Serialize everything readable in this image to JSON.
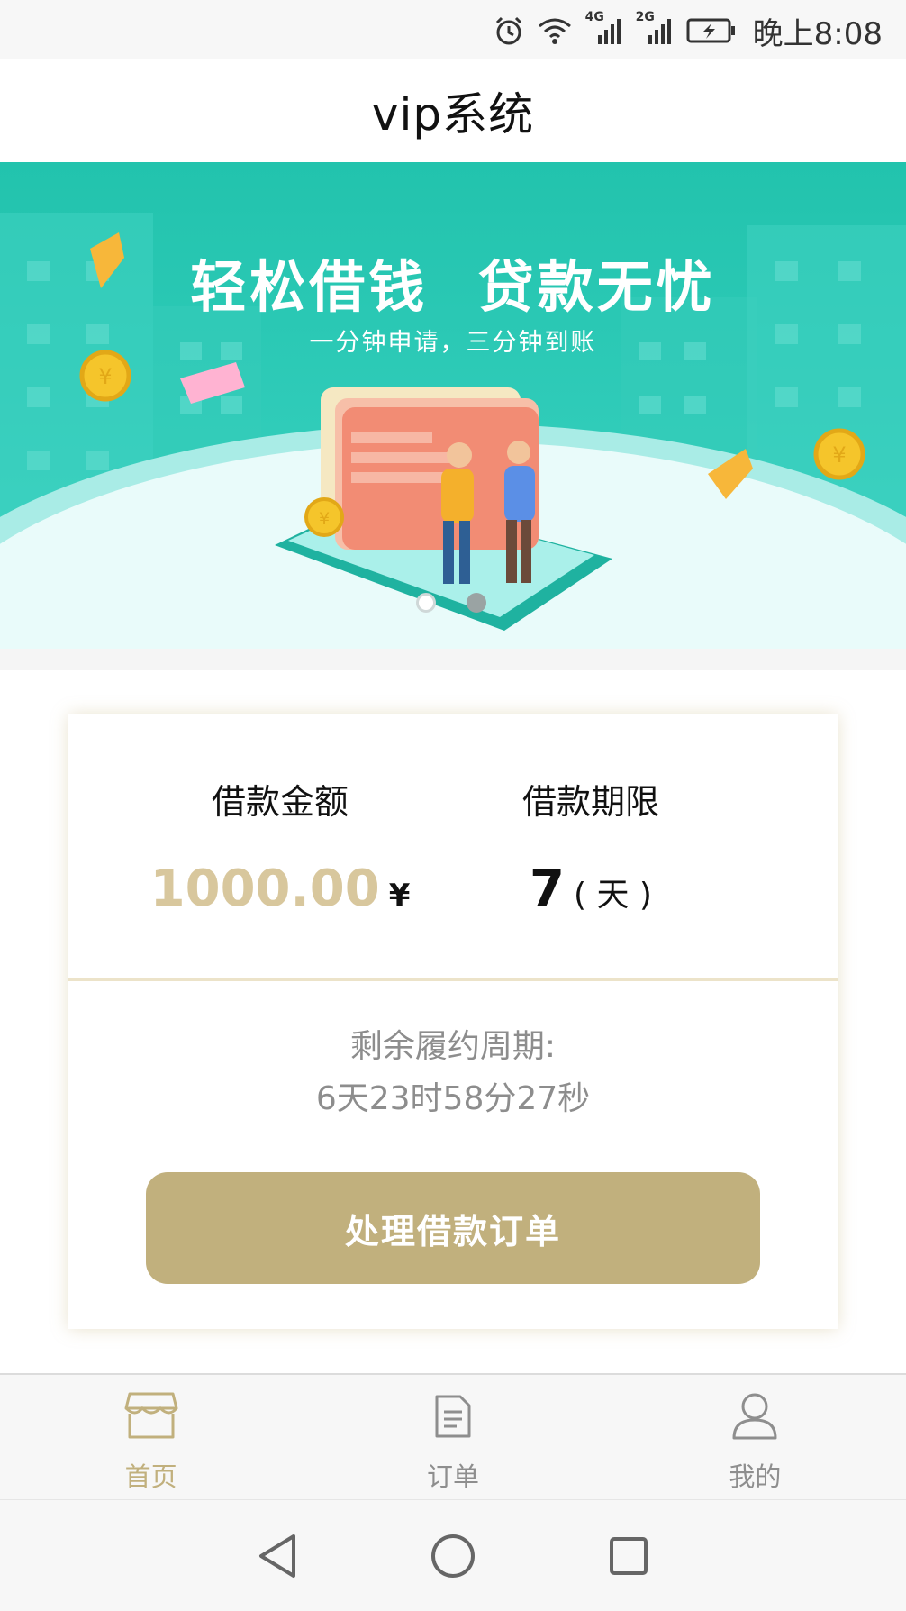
{
  "status_bar": {
    "network_1": "4G",
    "network_2": "2G",
    "time": "晚上8:08"
  },
  "header": {
    "title": "vip系统"
  },
  "banner": {
    "title": "轻松借钱 贷款无忧",
    "subtitle": "一分钟申请，三分钟到账",
    "slide_count": 2,
    "active_slide": 1
  },
  "loan": {
    "amount_label": "借款金额",
    "amount_value": "1000.00",
    "amount_unit": "¥",
    "term_label": "借款期限",
    "term_value": "7",
    "term_unit": "( 天 )",
    "remaining_label": "剩余履约周期:",
    "remaining_value": "6天23时58分27秒",
    "process_button": "处理借款订单"
  },
  "tabs": [
    {
      "label": "首页",
      "icon": "home-shop-icon",
      "active": true
    },
    {
      "label": "订单",
      "icon": "document-icon",
      "active": false
    },
    {
      "label": "我的",
      "icon": "user-icon",
      "active": false
    }
  ],
  "colors": {
    "accent": "#c1b07d",
    "amount": "#d8c79d",
    "banner": "#24c2ae"
  }
}
